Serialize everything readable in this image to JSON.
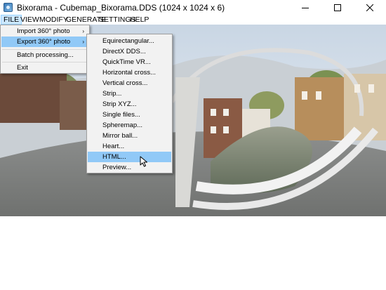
{
  "window": {
    "title": "Bixorama - Cubemap_Bixorama.DDS (1024 x 1024 x 6)",
    "controls": {
      "minimize": "minimize-icon",
      "maximize": "maximize-icon",
      "close": "close-icon"
    }
  },
  "menubar": {
    "items": [
      {
        "label": "FILE",
        "active": true
      },
      {
        "label": "VIEW"
      },
      {
        "label": "MODIFY"
      },
      {
        "label": "GENERATE"
      },
      {
        "label": "SETTINGS"
      },
      {
        "label": "HELP"
      }
    ]
  },
  "file_menu": {
    "items": [
      {
        "label": "Import 360° photo",
        "submenu": true
      },
      {
        "label": "Export 360° photo",
        "submenu": true,
        "highlighted": true
      },
      {
        "label": "Batch processing..."
      },
      {
        "label": "Exit"
      }
    ],
    "arrow": "›"
  },
  "export_submenu": {
    "items": [
      {
        "label": "Equirectangular..."
      },
      {
        "label": "DirectX DDS..."
      },
      {
        "label": "QuickTime VR..."
      },
      {
        "label": "Horizontal cross..."
      },
      {
        "label": "Vertical cross..."
      },
      {
        "label": "Strip..."
      },
      {
        "label": "Strip XYZ..."
      },
      {
        "label": "Single files..."
      },
      {
        "label": "Spheremap..."
      },
      {
        "label": "Mirror ball..."
      },
      {
        "label": "Heart..."
      },
      {
        "label": "HTML...",
        "highlighted": true
      },
      {
        "label": "Preview..."
      }
    ]
  },
  "colors": {
    "menu_highlight": "#91c9f7",
    "menubar_active": "#cce8ff",
    "menu_background": "#f2f2f2"
  }
}
